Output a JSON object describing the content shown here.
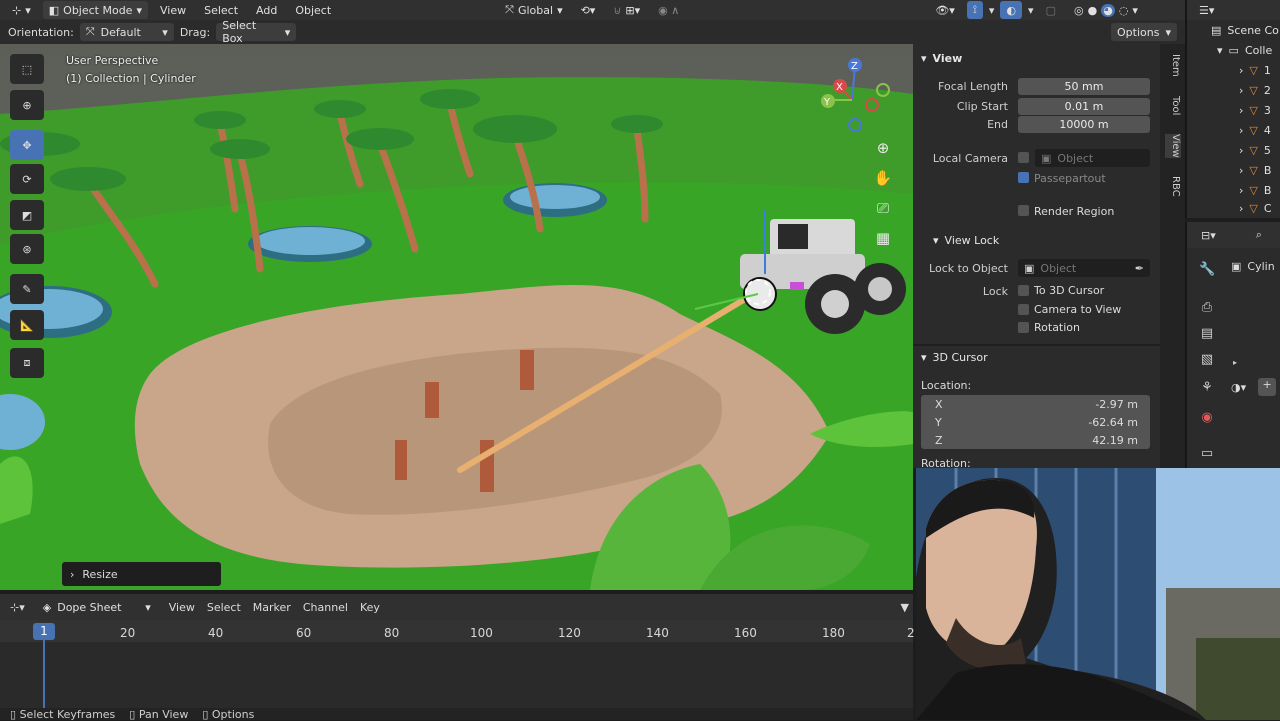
{
  "header": {
    "mode": "Object Mode",
    "menus": [
      "View",
      "Select",
      "Add",
      "Object"
    ],
    "transform_orientation": "Global"
  },
  "tool_settings": {
    "orientation_label": "Orientation:",
    "orientation_value": "Default",
    "drag_label": "Drag:",
    "drag_value": "Select Box",
    "options": "Options"
  },
  "viewport": {
    "perspective": "User Perspective",
    "collection": "(1) Collection | Cylinder",
    "resize_panel": "Resize",
    "gizmo_axes": [
      "Z",
      "X",
      "Y"
    ]
  },
  "npanel": {
    "view_section": "View",
    "focal_length_label": "Focal Length",
    "focal_length_value": "50 mm",
    "clip_start_label": "Clip Start",
    "clip_start_value": "0.01 m",
    "end_label": "End",
    "end_value": "10000 m",
    "local_camera_label": "Local Camera",
    "local_camera_placeholder": "Object",
    "passepartout": "Passepartout",
    "render_region": "Render Region",
    "view_lock_section": "View Lock",
    "lock_to_object_label": "Lock to Object",
    "lock_to_object_placeholder": "Object",
    "lock_label": "Lock",
    "to_3d_cursor": "To 3D Cursor",
    "camera_to_view": "Camera to View",
    "rotation_check": "Rotation",
    "cursor_section": "3D Cursor",
    "location_label": "Location:",
    "x_label": "X",
    "x_value": "-2.97 m",
    "y_label": "Y",
    "y_value": "-62.64 m",
    "z_label": "Z",
    "z_value": "42.19 m",
    "rotation_label": "Rotation:",
    "tabs": [
      "Item",
      "Tool",
      "View",
      "RBC"
    ]
  },
  "outliner": {
    "scene": "Scene Co",
    "collection": "Colle",
    "items": [
      "1",
      "2",
      "3",
      "4",
      "5",
      "B",
      "B",
      "C"
    ]
  },
  "properties": {
    "object_name": "Cylin"
  },
  "dopesheet": {
    "editor": "Dope Sheet",
    "menus": [
      "View",
      "Select",
      "Marker",
      "Channel",
      "Key"
    ],
    "current_frame": "1",
    "frames": [
      "20",
      "40",
      "60",
      "80",
      "100",
      "120",
      "140",
      "160",
      "180",
      "2"
    ]
  },
  "statusbar": {
    "items": [
      "Select Keyframes",
      "Pan View",
      "Options"
    ]
  }
}
